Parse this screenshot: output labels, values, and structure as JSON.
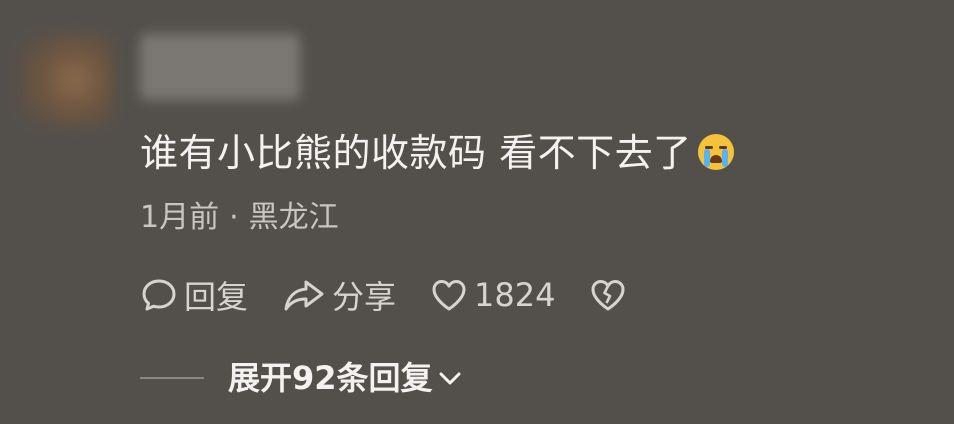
{
  "comment": {
    "text": "谁有小比熊的收款码  看不下去了",
    "emoji": "loudly-crying-face",
    "time": "1月前",
    "separator": "·",
    "location": "黑龙江",
    "actions": {
      "reply_label": "回复",
      "share_label": "分享",
      "like_count": "1824"
    },
    "expand_label": "展开92条回复"
  },
  "colors": {
    "background": "#53504c",
    "text": "#f3f2f0",
    "secondary_text": "#c9c6c2",
    "emoji_face": "#f5c33b"
  }
}
